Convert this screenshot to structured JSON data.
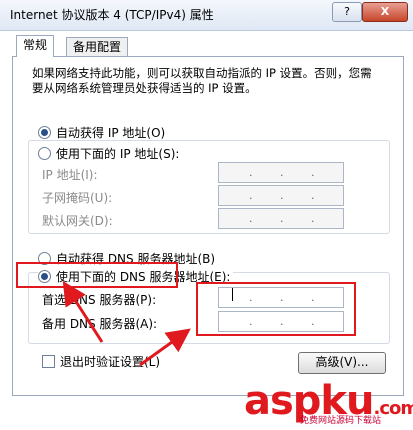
{
  "window": {
    "title": "Internet 协议版本 4 (TCP/IPv4) 属性",
    "help_label": "?",
    "close_label": "X"
  },
  "tabs": [
    {
      "label": "常规"
    },
    {
      "label": "备用配置"
    }
  ],
  "description": "如果网络支持此功能，则可以获取自动指派的 IP 设置。否则，您需要从网络系统管理员处获得适当的 IP 设置。",
  "ip_section": {
    "auto_label": "自动获得 IP 地址(O)",
    "manual_label": "使用下面的 IP 地址(S):",
    "ip_label": "IP 地址(I):",
    "mask_label": "子网掩码(U):",
    "gateway_label": "默认网关(D):"
  },
  "dns_section": {
    "auto_label": "自动获得 DNS 服务器地址(B)",
    "manual_label": "使用下面的 DNS 服务器地址(E):",
    "preferred_label": "首选 DNS 服务器(P):",
    "alternate_label": "备用 DNS 服务器(A):"
  },
  "validate_label": "退出时验证设置(L)",
  "advanced_label": "高级(V)...",
  "dot": ".",
  "watermark": {
    "text": "aspku",
    "suffix": ".com",
    "subtitle": "免费网站源码下载站"
  },
  "colors": {
    "accent": "#2a4f86",
    "annotation": "#e0191e"
  }
}
